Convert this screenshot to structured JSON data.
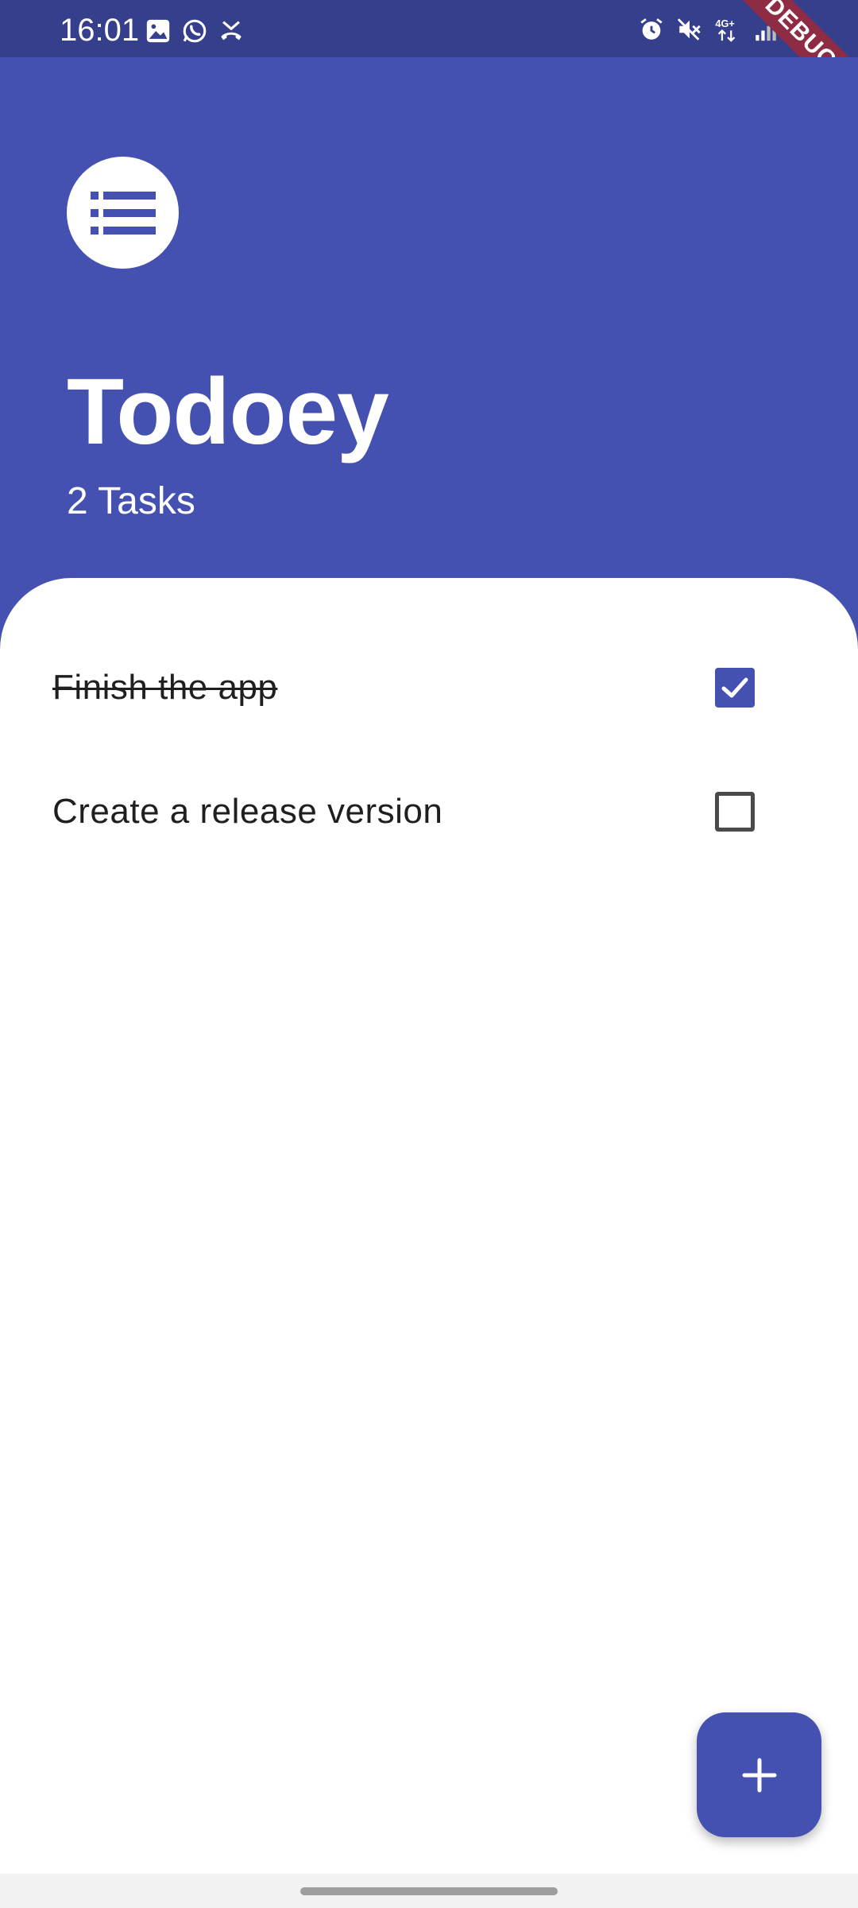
{
  "status_bar": {
    "time": "16:01",
    "left_icons": [
      "gallery-icon",
      "whatsapp-icon",
      "missed-call-icon"
    ],
    "right_icons": [
      "alarm-icon",
      "mute-icon",
      "4g-plus-icon",
      "signal-icon",
      "battery-icon"
    ],
    "network_label": "4G+"
  },
  "debug_banner": "DEBUG",
  "header": {
    "logo_icon": "list-icon",
    "title": "Todoey",
    "task_count": "2 Tasks"
  },
  "tasks": [
    {
      "label": "Finish the app",
      "done": true
    },
    {
      "label": "Create a release version",
      "done": false
    }
  ],
  "fab": {
    "icon": "plus-icon"
  },
  "colors": {
    "primary": "#4551B1",
    "status_bar": "#353F8C",
    "debug_banner": "#8E2C45",
    "sheet": "#FFFFFF"
  }
}
